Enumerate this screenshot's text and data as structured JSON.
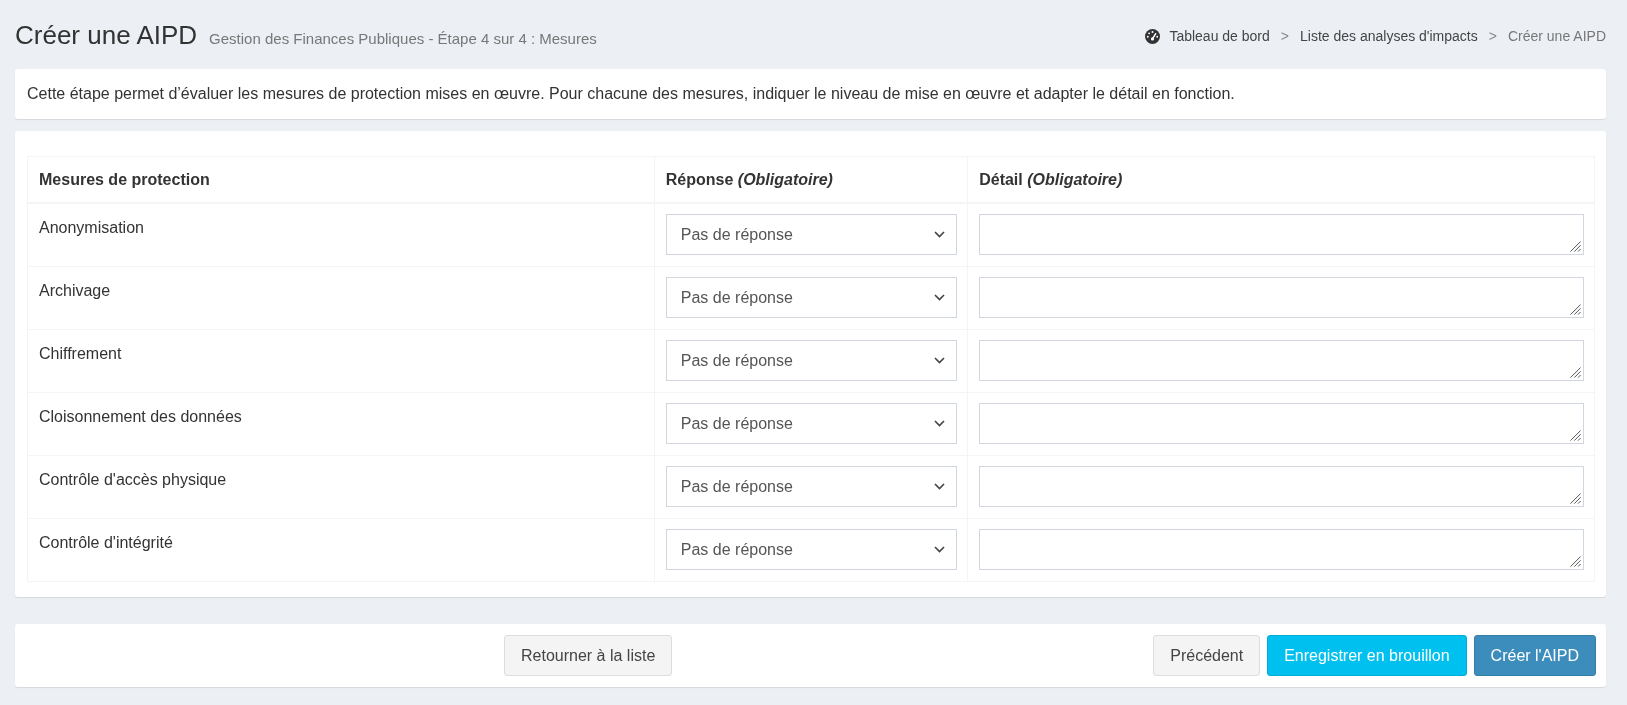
{
  "page_header": {
    "title": "Créer une AIPD",
    "subtitle": "Gestion des Finances Publiques - Étape 4 sur 4 : Mesures"
  },
  "breadcrumb": [
    {
      "kind": "home",
      "label": "Tableau de bord"
    },
    {
      "kind": "separator",
      "label": ">"
    },
    {
      "kind": "link",
      "label": "Liste des analyses d'impacts"
    },
    {
      "kind": "separator",
      "label": ">"
    },
    {
      "kind": "current",
      "label": "Créer une AIPD"
    }
  ],
  "info": "Cette étape permet d’évaluer les mesures de protection mises en œuvre. Pour chacune des mesures, indiquer le niveau de mise en œuvre et adapter le détail en fonction.",
  "table": {
    "columns": [
      "Mesures de protection",
      "Réponse *(Obligatoire)*",
      "Détail *(Obligatoire)*"
    ],
    "rows": [
      {
        "measure": "Anonymisation",
        "response": "Pas de réponse"
      },
      {
        "measure": "Archivage",
        "response": "Pas de réponse"
      },
      {
        "measure": "Chiffrement",
        "response": "Pas de réponse"
      },
      {
        "measure": "Cloisonnement des données",
        "response": "Pas de réponse"
      },
      {
        "measure": "Contrôle d'accès physique",
        "response": "Pas de réponse"
      },
      {
        "measure": "Contrôle d'intégrité",
        "response": "Pas de réponse"
      }
    ]
  },
  "actions": {
    "left": [
      {
        "kind": "default",
        "label": "Retourner à la liste"
      }
    ],
    "right": [
      {
        "kind": "default",
        "label": "Précédent"
      },
      {
        "kind": "info",
        "label": "Enregistrer en brouillon"
      },
      {
        "kind": "primary",
        "label": "Créer l'AIPD"
      }
    ]
  }
}
